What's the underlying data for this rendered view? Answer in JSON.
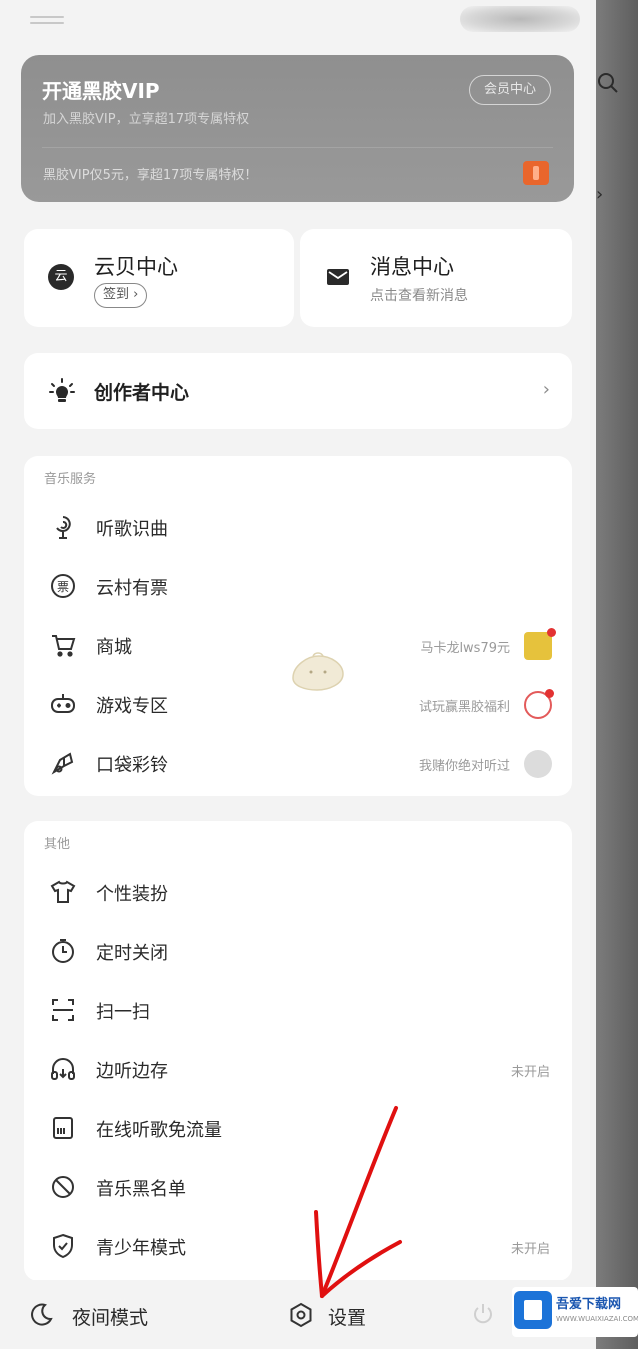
{
  "vip_banner": {
    "title": "开通黑胶VIP",
    "subtitle": "加入黑胶VIP，立享超17项专属特权",
    "member_center_label": "会员中心",
    "promo_text": "黑胶VIP仅5元，享超17项专属特权！"
  },
  "quick_cards": {
    "cloud_coin": {
      "title": "云贝中心",
      "action_label": "签到 ›"
    },
    "messages": {
      "title": "消息中心",
      "subtitle": "点击查看新消息"
    }
  },
  "creator": {
    "label": "创作者中心"
  },
  "music_services": {
    "section_label": "音乐服务",
    "items": [
      {
        "label": "听歌识曲",
        "icon": "voice-search-icon",
        "right_text": ""
      },
      {
        "label": "云村有票",
        "icon": "ticket-icon",
        "right_text": ""
      },
      {
        "label": "商城",
        "icon": "cart-icon",
        "right_text": "马卡龙lws79元"
      },
      {
        "label": "游戏专区",
        "icon": "gamepad-icon",
        "right_text": "试玩赢黑胶福利"
      },
      {
        "label": "口袋彩铃",
        "icon": "ringtone-icon",
        "right_text": "我赌你绝对听过"
      }
    ]
  },
  "other": {
    "section_label": "其他",
    "items": [
      {
        "label": "个性装扮",
        "icon": "shirt-icon",
        "right_text": ""
      },
      {
        "label": "定时关闭",
        "icon": "timer-icon",
        "right_text": ""
      },
      {
        "label": "扫一扫",
        "icon": "scan-icon",
        "right_text": ""
      },
      {
        "label": "边听边存",
        "icon": "headphone-download-icon",
        "right_text": "未开启"
      },
      {
        "label": "在线听歌免流量",
        "icon": "sim-card-icon",
        "right_text": ""
      },
      {
        "label": "音乐黑名单",
        "icon": "block-icon",
        "right_text": ""
      },
      {
        "label": "青少年模式",
        "icon": "shield-icon",
        "right_text": "未开启"
      }
    ]
  },
  "bottom_bar": {
    "night_mode_label": "夜间模式",
    "settings_label": "设置"
  },
  "watermark": {
    "title": "吾爱下载网",
    "url": "WWW.WUAIXIAZAI.COM"
  },
  "colors": {
    "accent_red": "#e33232",
    "vip_gift": "#e9662c",
    "annotation_arrow": "#e01010"
  }
}
